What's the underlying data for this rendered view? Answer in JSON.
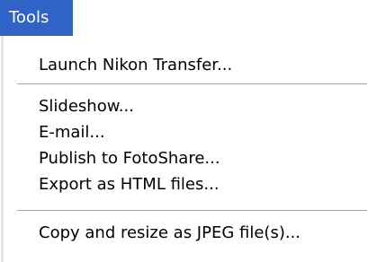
{
  "menubar": {
    "active_menu": "Tools"
  },
  "menu": {
    "items": [
      {
        "label": "Launch Nikon Transfer..."
      },
      {
        "label": "Slideshow..."
      },
      {
        "label": "E-mail..."
      },
      {
        "label": "Publish to FotoShare..."
      },
      {
        "label": "Export as HTML files..."
      },
      {
        "label": "Copy and resize as JPEG file(s)..."
      }
    ]
  },
  "colors": {
    "menubar_active_bg": "#2f63c8",
    "menubar_active_text": "#ffffff",
    "menu_text": "#000000",
    "separator": "#a8a8a8"
  }
}
